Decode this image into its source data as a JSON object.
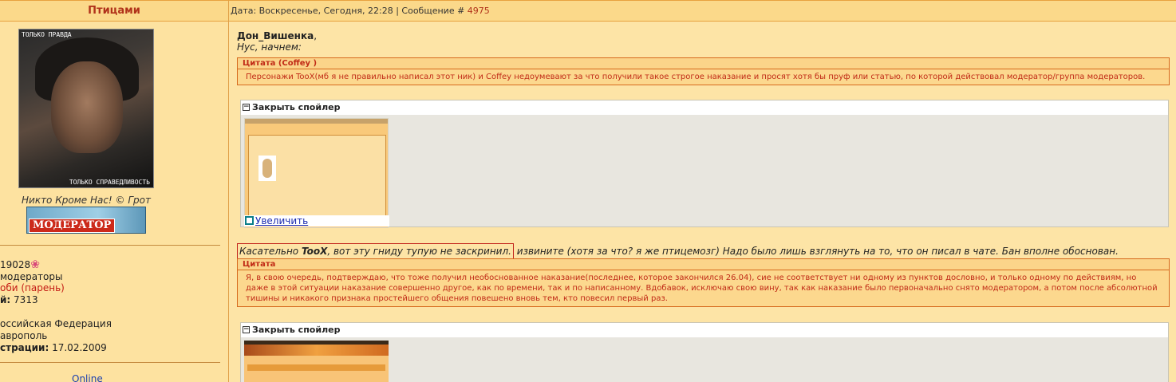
{
  "sidebar": {
    "header": "Птицами",
    "avatar_top_text": "ТОЛЬКО ПРАВДА",
    "avatar_bottom_text": "ТОЛЬКО СПРАВЕДЛИВОСТЬ",
    "motto": "Никто Кроме Нас! © Грот",
    "badge": "МОДЕРАТОР",
    "reputation": "19028",
    "group": "модераторы",
    "gender_label_fragment": "оби (парень)",
    "posts_label": "й:",
    "posts_value": "7313",
    "country": "оссийская Федерация",
    "city": "аврополь",
    "registered_label": "страции:",
    "registered_value": "17.02.2009",
    "status": "Online"
  },
  "post": {
    "header_prefix": "Дата: Воскресенье, Сегодня, 22:28 | Сообщение # ",
    "message_number": "4975",
    "author": "Дон_Вишенка",
    "author_suffix": ",",
    "intro": "Нус, начнем:",
    "quote1_title": "Цитата (Coffey )",
    "quote1_body": "Персонажи TooX(мб я не правильно написал этот ник) и Coffey недоумевают за что получили такое строгое наказание и просят хотя бы пруф или статью, по которой действовал модератор/группа модераторов.",
    "spoiler1_title": "Закрыть спойлер",
    "zoom_label": "Увеличить",
    "reply_boxed_prefix": "Касательно ",
    "reply_boxed_name": "TooX",
    "reply_boxed_suffix": ", вот эту гниду тупую не заскринил.",
    "reply_rest": " извините (хотя за что? я же птицемозг) Надо было лишь взглянуть на то, что он писал в чате. Бан вполне обоснован.",
    "quote2_title": "Цитата",
    "quote2_body": "Я, в свою очередь, подтверждаю, что тоже получил необоснованное наказание(последнее, которое закончился 26.04), сие не соответствует ни одному из пунктов дословно, и только одному по действиям, но даже в этой ситуации наказание совершенно другое, как по времени, так и по написанному. Вдобавок, исключаю свою вину, так как наказание было первоначально снято модератором, а потом после абсолютной тишины и никакого признака простейшего общения повешено вновь тем, кто повесил первый раз.",
    "spoiler2_title": "Закрыть спойлер"
  },
  "colors": {
    "accent_red": "#b0321a",
    "quote_border": "#d66a1e",
    "link_blue": "#1a2ab0",
    "background": "#fde4a6"
  }
}
